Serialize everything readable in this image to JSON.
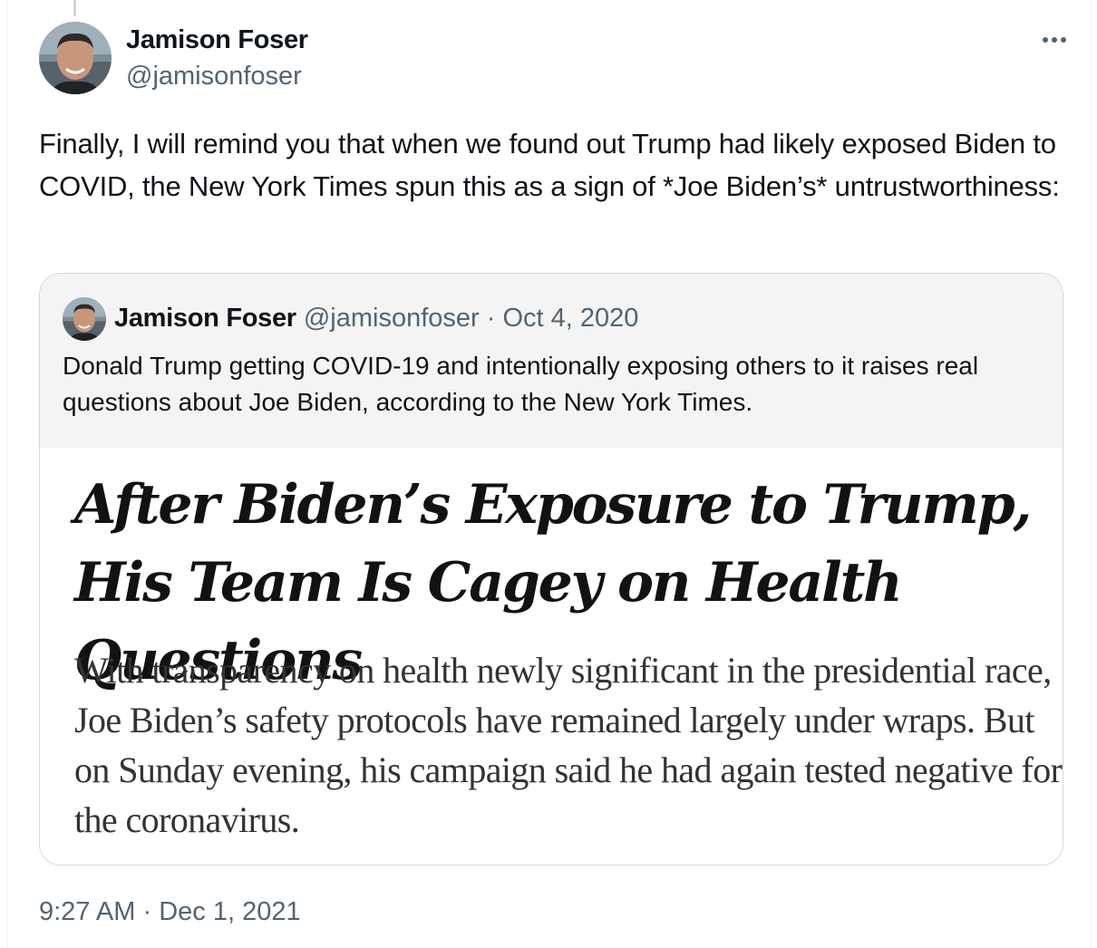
{
  "tweet": {
    "author": {
      "name": "Jamison Foser",
      "handle": "@jamisonfoser"
    },
    "more_icon": "more-horizontal-icon",
    "text": "Finally, I will remind you that when we found out Trump had likely exposed Biden to COVID, the New York Times spun this as a sign of *Joe Biden’s* untrustworthiness:",
    "time": "9:27 AM",
    "separator": "·",
    "date": "Dec 1, 2021"
  },
  "quoted_tweet": {
    "author": {
      "name": "Jamison Foser",
      "handle": "@jamisonfoser"
    },
    "separator": "·",
    "date": "Oct 4, 2020",
    "text": "Donald Trump getting COVID-19 and intentionally exposing others to it raises real questions about Joe Biden, according to the New York Times.",
    "media": {
      "headline": "After Biden’s Exposure to Trump, His Team Is Cagey on Health Questions",
      "summary": "With transparency on health newly significant in the presidential race, Joe Biden’s safety protocols have remained largely under wraps. But on Sunday evening, his campaign said he had again tested negative for the coronavirus."
    }
  },
  "colors": {
    "text_primary": "#0f1419",
    "text_secondary": "#536471",
    "border": "#cfd9de",
    "quote_header_bg": "#f4f4f4"
  }
}
